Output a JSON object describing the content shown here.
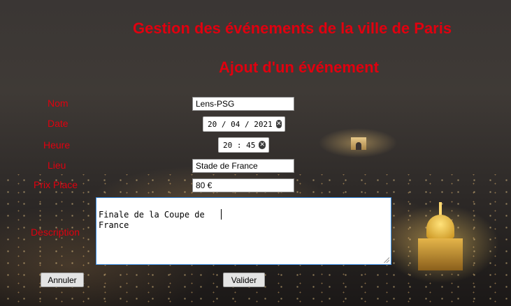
{
  "header": {
    "title": "Gestion des événements de la ville de Paris",
    "subtitle": "Ajout d'un événement"
  },
  "form": {
    "nom": {
      "label": "Nom",
      "value": "Lens-PSG"
    },
    "date": {
      "label": "Date",
      "day": "20",
      "month": "04",
      "year": "2021"
    },
    "heure": {
      "label": "Heure",
      "hour": "20",
      "minute": "45"
    },
    "lieu": {
      "label": "Lieu",
      "value": "Stade de France"
    },
    "prix": {
      "label": "Prix Place",
      "value": "80 €"
    },
    "description": {
      "label": "Description",
      "value": "Finale de la Coupe de \nFrance"
    }
  },
  "buttons": {
    "cancel_label": "Annuler",
    "submit_label": "Valider"
  },
  "icons": {
    "clear": "clear-icon",
    "resize": "resize-grip-icon"
  },
  "colors": {
    "label_red": "#e0000f",
    "focus_border": "#3a8ee6"
  }
}
